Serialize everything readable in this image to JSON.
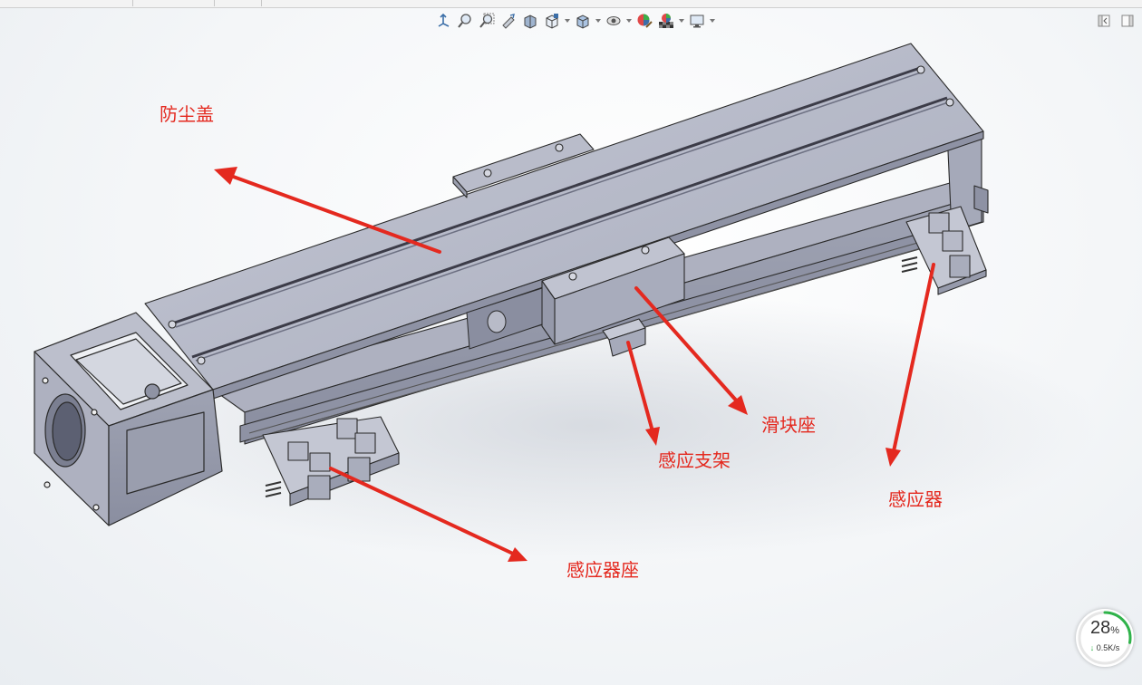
{
  "toolbar": {
    "icons": [
      "view-orientation-icon",
      "zoom-to-fit-icon",
      "zoom-area-icon",
      "previous-view-icon",
      "section-view-icon",
      "view-orientation-cube-icon",
      "display-style-icon",
      "hide-show-items-icon",
      "edit-appearance-icon",
      "apply-scene-icon",
      "view-settings-icon"
    ]
  },
  "labels": {
    "dust_cover": "防尘盖",
    "slider_seat": "滑块座",
    "sensor_bracket": "感应支架",
    "sensor": "感应器",
    "sensor_seat": "感应器座"
  },
  "colors": {
    "annotation": "#e4291f",
    "model_body": "#b9bcc9",
    "model_edge": "#2a2a2a",
    "progress_ring": "#2fb34a"
  },
  "speed_widget": {
    "percent": "28",
    "percent_unit": "%",
    "rate": "0.5K/s",
    "progress": 0.28
  }
}
